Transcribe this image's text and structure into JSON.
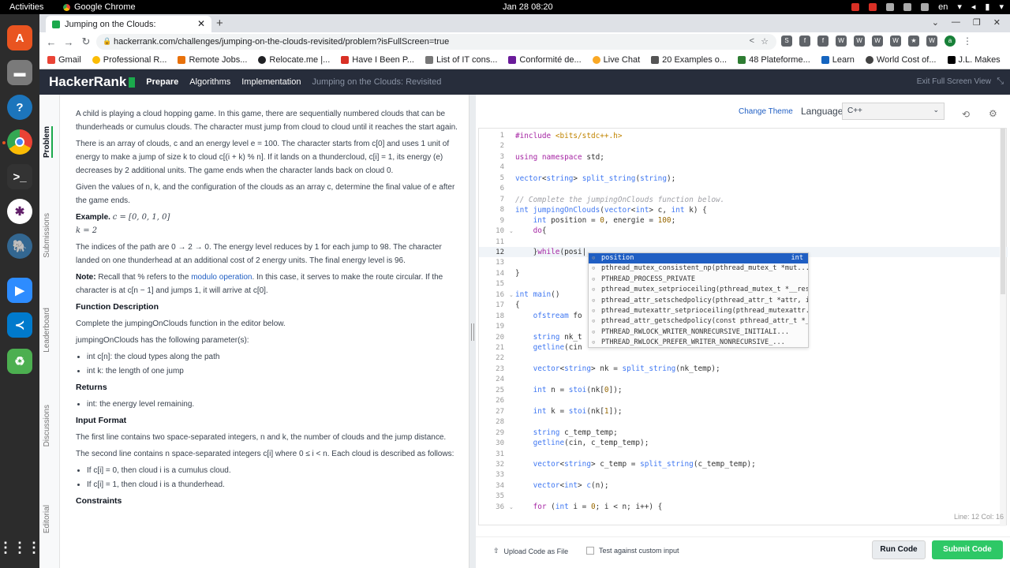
{
  "os": {
    "activities": "Activities",
    "app_name": "Google Chrome",
    "clock": "Jan 28  08:20",
    "lang": "en"
  },
  "browser": {
    "tab_title": "Jumping on the Clouds:",
    "url": "hackerrank.com/challenges/jumping-on-the-clouds-revisited/problem?isFullScreen=true",
    "bookmarks": [
      "Gmail",
      "Professional R...",
      "Remote Jobs...",
      "Relocate.me |...",
      "Have I Been P...",
      "List of IT cons...",
      "Conformité de...",
      "Live Chat",
      "20 Examples o...",
      "48 Plateforme...",
      "Learn",
      "World Cost of...",
      "J.L. Makes"
    ],
    "extensions": [
      "S",
      "f",
      "f",
      "W",
      "W",
      "W",
      "W",
      "★",
      "W"
    ],
    "avatar": "a"
  },
  "header": {
    "logo": "HackerRank",
    "crumbs": [
      "Prepare",
      "Algorithms",
      "Implementation",
      "Jumping on the Clouds: Revisited"
    ],
    "exit_fullscreen": "Exit Full Screen View"
  },
  "sidebar_tabs": [
    "Problem",
    "Submissions",
    "Leaderboard",
    "Discussions",
    "Editorial"
  ],
  "problem": {
    "p1": "A child is playing a cloud hopping game. In this game, there are sequentially numbered clouds that can be thunderheads or cumulus clouds. The character must jump from cloud to cloud until it reaches the start again.",
    "p2": "There is an array of clouds, c and an energy level e = 100. The character starts from c[0] and uses 1 unit of energy to make a jump of size k to cloud c[(i + k) % n]. If it lands on a thundercloud, c[i] = 1, its energy (e) decreases by 2 additional units. The game ends when the character lands back on cloud 0.",
    "p3": "Given the values of n, k, and the configuration of the clouds as an array c, determine the final value of e after the game ends.",
    "example_label": "Example.",
    "example_c": "c = [0, 0, 1, 0]",
    "example_k": "k = 2",
    "p4": "The indices of the path are 0 → 2 → 0. The energy level reduces by 1 for each jump to 98. The character landed on one thunderhead at an additional cost of 2 energy units. The final energy level is 96.",
    "note_label": "Note:",
    "note_text_a": "Recall that % refers to the",
    "note_link": "modulo operation",
    "note_text_b": ". In this case, it serves to make the route circular. If the character is at c[n − 1] and jumps 1, it will arrive at c[0].",
    "fd_title": "Function Description",
    "fd_text": "Complete the jumpingOnClouds function in the editor below.",
    "fd_params": "jumpingOnClouds has the following parameter(s):",
    "params": [
      "int c[n]: the cloud types along the path",
      "int k: the length of one jump"
    ],
    "returns_title": "Returns",
    "returns": [
      "int: the energy level remaining."
    ],
    "input_title": "Input Format",
    "input_p1": "The first line contains two space-separated integers, n and k, the number of clouds and the jump distance.",
    "input_p2": "The second line contains n space-separated integers c[i] where 0 ≤ i < n. Each cloud is described as follows:",
    "input_items": [
      "If c[i] = 0, then cloud i is a cumulus cloud.",
      "If c[i] = 1, then cloud i is a thunderhead."
    ],
    "constraints_title": "Constraints"
  },
  "editor": {
    "change_theme": "Change Theme",
    "language_label": "Language",
    "language": "C++",
    "line_numbers": [
      "1",
      "2",
      "3",
      "4",
      "5",
      "6",
      "7",
      "8",
      "9",
      "10",
      "11",
      "12",
      "13",
      "14",
      "15",
      "16",
      "17",
      "18",
      "19",
      "20",
      "21",
      "22",
      "23",
      "24",
      "25",
      "26",
      "27",
      "28",
      "29",
      "30",
      "31",
      "32",
      "33",
      "34",
      "35",
      "36"
    ],
    "autocomplete": [
      {
        "label": "position",
        "type": "int"
      },
      {
        "label": "pthread_mutex_consistent_np(pthread_mutex_t *mut...",
        "type": ""
      },
      {
        "label": "PTHREAD_PROCESS_PRIVATE",
        "type": ""
      },
      {
        "label": "pthread_mutex_setprioceiling(pthread_mutex_t *__res...",
        "type": ""
      },
      {
        "label": "pthread_attr_setschedpolicy(pthread_attr_t *attr, int p...",
        "type": ""
      },
      {
        "label": "pthread_mutexattr_setprioceiling(pthread_mutexattr...",
        "type": ""
      },
      {
        "label": "pthread_attr_getschedpolicy(const pthread_attr_t *__r...",
        "type": ""
      },
      {
        "label": "PTHREAD_RWLOCK_WRITER_NONRECURSIVE_INITIALI...",
        "type": ""
      },
      {
        "label": "PTHREAD_RWLOCK_PREFER_WRITER_NONRECURSIVE_...",
        "type": ""
      }
    ],
    "status": "Line: 12 Col: 16"
  },
  "footer": {
    "upload": "Upload Code as File",
    "custom_input": "Test against custom input",
    "run": "Run Code",
    "submit": "Submit Code"
  }
}
